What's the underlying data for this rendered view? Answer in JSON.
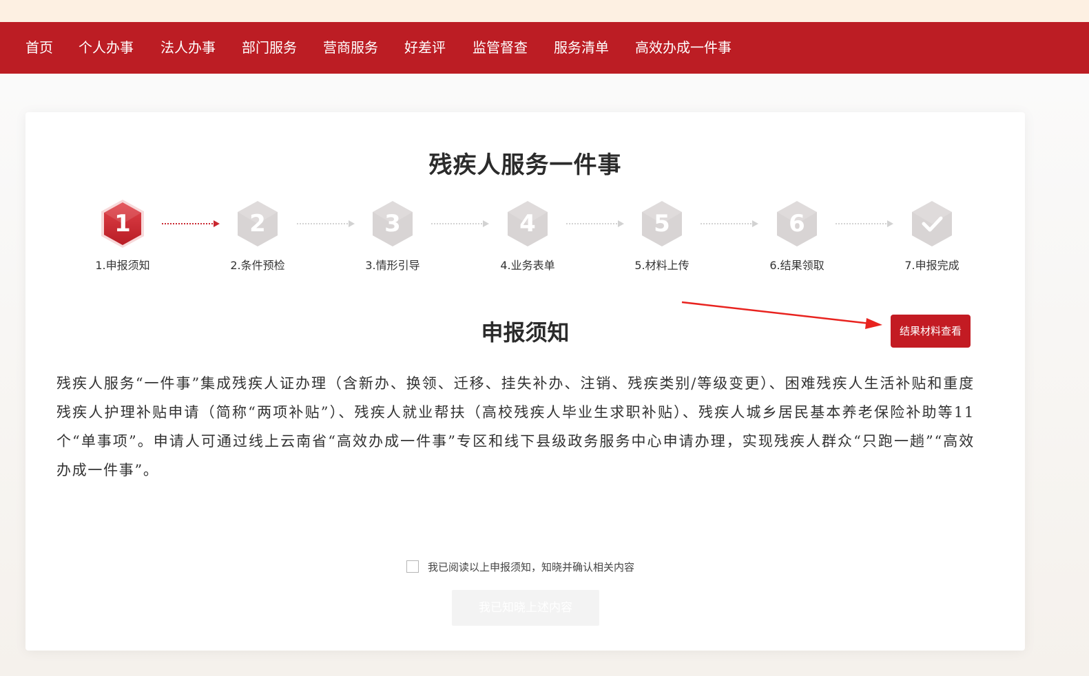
{
  "nav": {
    "items": [
      {
        "label": "首页"
      },
      {
        "label": "个人办事"
      },
      {
        "label": "法人办事"
      },
      {
        "label": "部门服务"
      },
      {
        "label": "营商服务"
      },
      {
        "label": "好差评"
      },
      {
        "label": "监管督查"
      },
      {
        "label": "服务清单"
      },
      {
        "label": "高效办成一件事"
      }
    ]
  },
  "page": {
    "title": "残疾人服务一件事"
  },
  "steps": [
    {
      "number": "1",
      "label": "1.申报须知",
      "state": "active"
    },
    {
      "number": "2",
      "label": "2.条件预检",
      "state": "pending"
    },
    {
      "number": "3",
      "label": "3.情形引导",
      "state": "pending"
    },
    {
      "number": "4",
      "label": "4.业务表单",
      "state": "pending"
    },
    {
      "number": "5",
      "label": "5.材料上传",
      "state": "pending"
    },
    {
      "number": "6",
      "label": "6.结果领取",
      "state": "pending"
    },
    {
      "number": "",
      "label": "7.申报完成",
      "state": "pending",
      "icon": "check-icon"
    }
  ],
  "notice": {
    "title": "申报须知",
    "result_button": "结果材料查看",
    "body": "残疾人服务“一件事”集成残疾人证办理（含新办、换领、迁移、挂失补办、注销、残疾类别/等级变更）、困难残疾人生活补贴和重度残疾人护理补贴申请（简称“两项补贴”）、残疾人就业帮扶（高校残疾人毕业生求职补贴）、残疾人城乡居民基本养老保险补助等11个“单事项”。申请人可通过线上云南省“高效办成一件事”专区和线下县级政务服务中心申请办理，实现残疾人群众“只跑一趟”“高效办成一件事”。"
  },
  "agreement": {
    "checkbox_label": "我已阅读以上申报须知，知晓并确认相关内容",
    "checked": false,
    "confirm_button": "我已知晓上述内容"
  },
  "colors": {
    "brand_red": "#bc1d24",
    "active_step": "#c9272f",
    "pending_step": "#d6d2d2",
    "annotation_arrow": "#e8231f"
  }
}
